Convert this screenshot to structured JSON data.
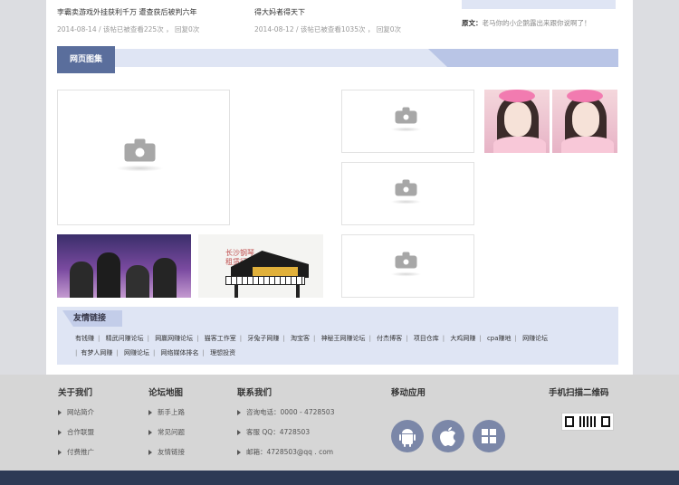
{
  "posts": [
    {
      "title": "孛霸卖游戏外挂获利千万 遭查获后被判六年",
      "meta": "2014-08-14 / 该帖已被查看225次 ， 回复0次"
    },
    {
      "title": "得大妈者得天下",
      "meta": "2014-08-12 / 该帖已被查看1035次 ， 回复0次"
    }
  ],
  "quote": {
    "label": "原文：",
    "text": "老马你的小企鹅露出来跟你说啊了！"
  },
  "gallery": {
    "title": "网页图集",
    "caption_piano": "长沙钢琴 租赁行情"
  },
  "links": {
    "title": "友情链接",
    "row1": [
      "有钱赚",
      "精武问赚论坛",
      "网赢网赚论坛",
      "猫客工作室",
      "牙兔子网赚",
      "淘宝客",
      "神秘王网赚论坛",
      "付杰博客",
      "项目仓库",
      "大鸡网赚",
      "cpa赚地",
      "网赚论坛"
    ],
    "row2": [
      "有梦人网赚",
      "网赚论坛",
      "网络媒体排名",
      "理想投资"
    ]
  },
  "footer": {
    "about": {
      "title": "关于我们",
      "items": [
        "网站简介",
        "合作联盟",
        "付费推广"
      ]
    },
    "map": {
      "title": "论坛地图",
      "items": [
        "新手上路",
        "常见问题",
        "友情链接"
      ]
    },
    "contact": {
      "title": "联系我们",
      "items": [
        "咨询电话：0000 - 4728503",
        "客服 QQ：4728503",
        "邮箱：4728503@qq . com"
      ]
    },
    "mobile": {
      "title": "移动应用"
    },
    "qr": {
      "title": "手机扫描二维码"
    }
  },
  "colors": {
    "accent": "#5a6e9c",
    "band": "#dfe5f4",
    "footer_bar": "#2d3a55"
  }
}
